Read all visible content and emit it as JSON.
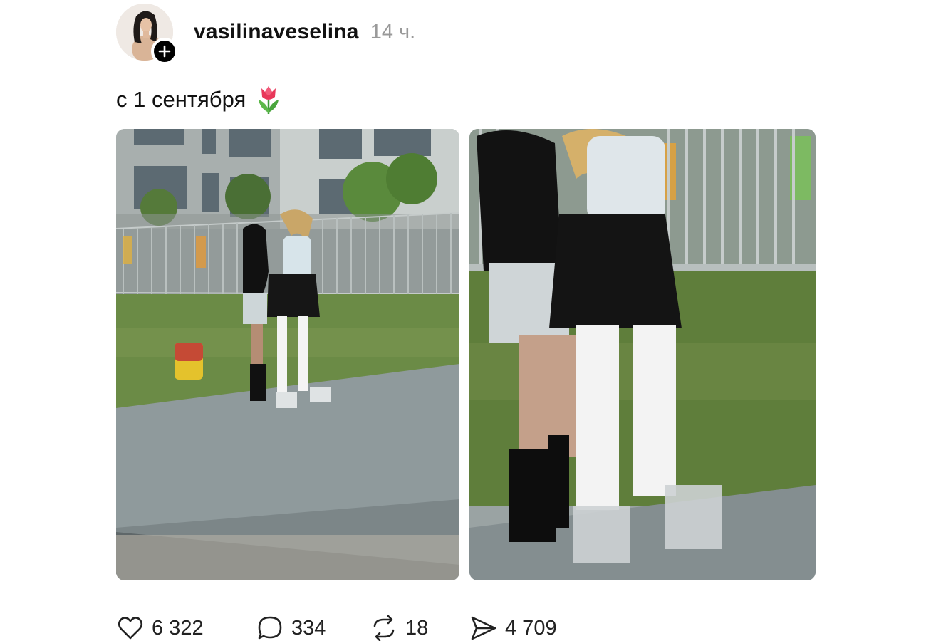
{
  "post": {
    "author": {
      "username": "vasilinaveselina",
      "avatar_icon": "avatar-photo",
      "follow_icon": "plus-icon"
    },
    "timestamp": "14 ч.",
    "caption": {
      "text": "с 1 сентября",
      "emoji_icon": "tulip-icon"
    },
    "media": [
      {
        "icon": "photo-two-girls-walking-schoolyard-wide"
      },
      {
        "icon": "photo-two-girls-walking-closeup"
      }
    ],
    "actions": {
      "likes": {
        "icon": "heart-icon",
        "count": "6 322"
      },
      "comments": {
        "icon": "comment-icon",
        "count": "334"
      },
      "reposts": {
        "icon": "repost-icon",
        "count": "18"
      },
      "shares": {
        "icon": "send-icon",
        "count": "4 709"
      }
    }
  },
  "colors": {
    "text_primary": "#111111",
    "text_secondary": "#999999",
    "background": "#ffffff",
    "badge": "#000000"
  }
}
